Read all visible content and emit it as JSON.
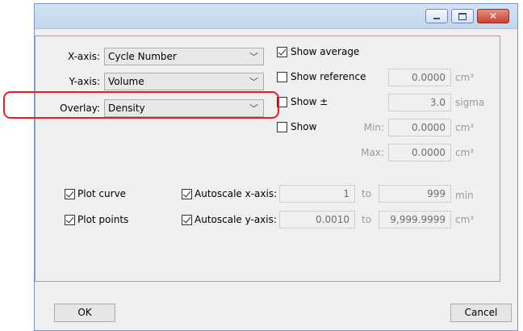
{
  "window": {
    "controls": [
      "minimize",
      "maximize",
      "close"
    ],
    "close_color": "#c8432f"
  },
  "axes": {
    "x_label": "X-axis:",
    "x_value": "Cycle Number",
    "y_label": "Y-axis:",
    "y_value": "Volume",
    "overlay_label": "Overlay:",
    "overlay_value": "Density",
    "highlight_color": "#ee1c1c"
  },
  "options": {
    "show_average": {
      "label": "Show average",
      "checked": true
    },
    "show_reference": {
      "label": "Show reference",
      "checked": false,
      "value": "0.0000",
      "unit": "cm³"
    },
    "show_pm": {
      "label": "Show ±",
      "checked": false,
      "value": "3.0",
      "unit": "sigma"
    },
    "show_range": {
      "label": "Show",
      "checked": false,
      "min_label": "Min:",
      "min_value": "0.0000",
      "min_unit": "cm³",
      "max_label": "Max:",
      "max_value": "0.0000",
      "max_unit": "cm³"
    }
  },
  "plot": {
    "plot_curve": {
      "label": "Plot curve",
      "checked": true
    },
    "plot_points": {
      "label": "Plot points",
      "checked": true
    },
    "autoscale_x": {
      "label": "Autoscale x-axis:",
      "checked": true,
      "from": "1",
      "to_label": "to",
      "to": "999",
      "unit": "min"
    },
    "autoscale_y": {
      "label": "Autoscale y-axis:",
      "checked": true,
      "from": "0.0010",
      "to_label": "to",
      "to": "9,999.9999",
      "unit": "cm³"
    }
  },
  "buttons": {
    "ok": "OK",
    "cancel": "Cancel"
  }
}
